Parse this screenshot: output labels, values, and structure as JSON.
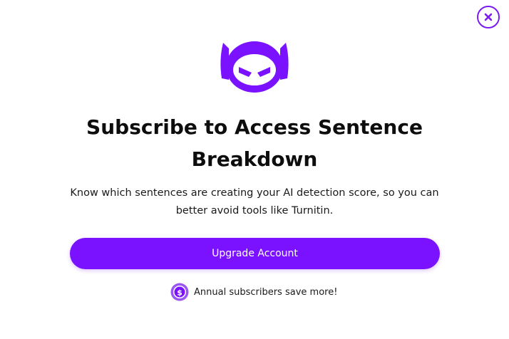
{
  "modal": {
    "title": "Subscribe to Access Sentence Breakdown",
    "description": "Know which sentences are creating your AI detection score, so you can better avoid tools like Turnitin.",
    "upgrade_label": "Upgrade Account",
    "promo_text": "Annual subscribers save more!",
    "accent_color": "#7a12ff",
    "icons": [
      "close-icon",
      "robot-mascot-icon",
      "dollar-coin-icon"
    ]
  }
}
